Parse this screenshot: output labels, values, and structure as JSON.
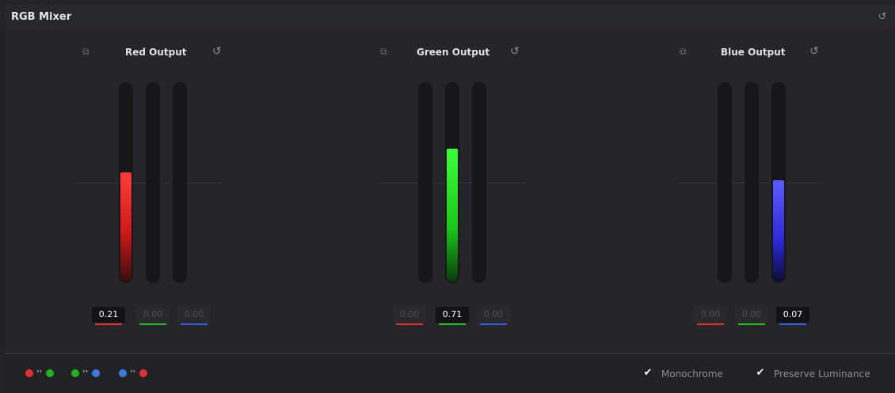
{
  "panel": {
    "title": "RGB Mixer"
  },
  "outputs": [
    {
      "title": "Red Output",
      "values": [
        "0.21",
        "0.00",
        "0.00"
      ],
      "active_index": 0,
      "level": 0.21
    },
    {
      "title": "Green Output",
      "values": [
        "0.00",
        "0.71",
        "0.00"
      ],
      "active_index": 1,
      "level": 0.71
    },
    {
      "title": "Blue Output",
      "values": [
        "0.00",
        "0.00",
        "0.07"
      ],
      "active_index": 2,
      "level": 0.07
    }
  ],
  "footer": {
    "monochrome_label": "Monochrome",
    "monochrome_checked": true,
    "preserve_label": "Preserve Luminance",
    "preserve_checked": true
  },
  "colors": {
    "red": "#e53030",
    "green": "#22c022",
    "blue": "#3a5ae0"
  }
}
